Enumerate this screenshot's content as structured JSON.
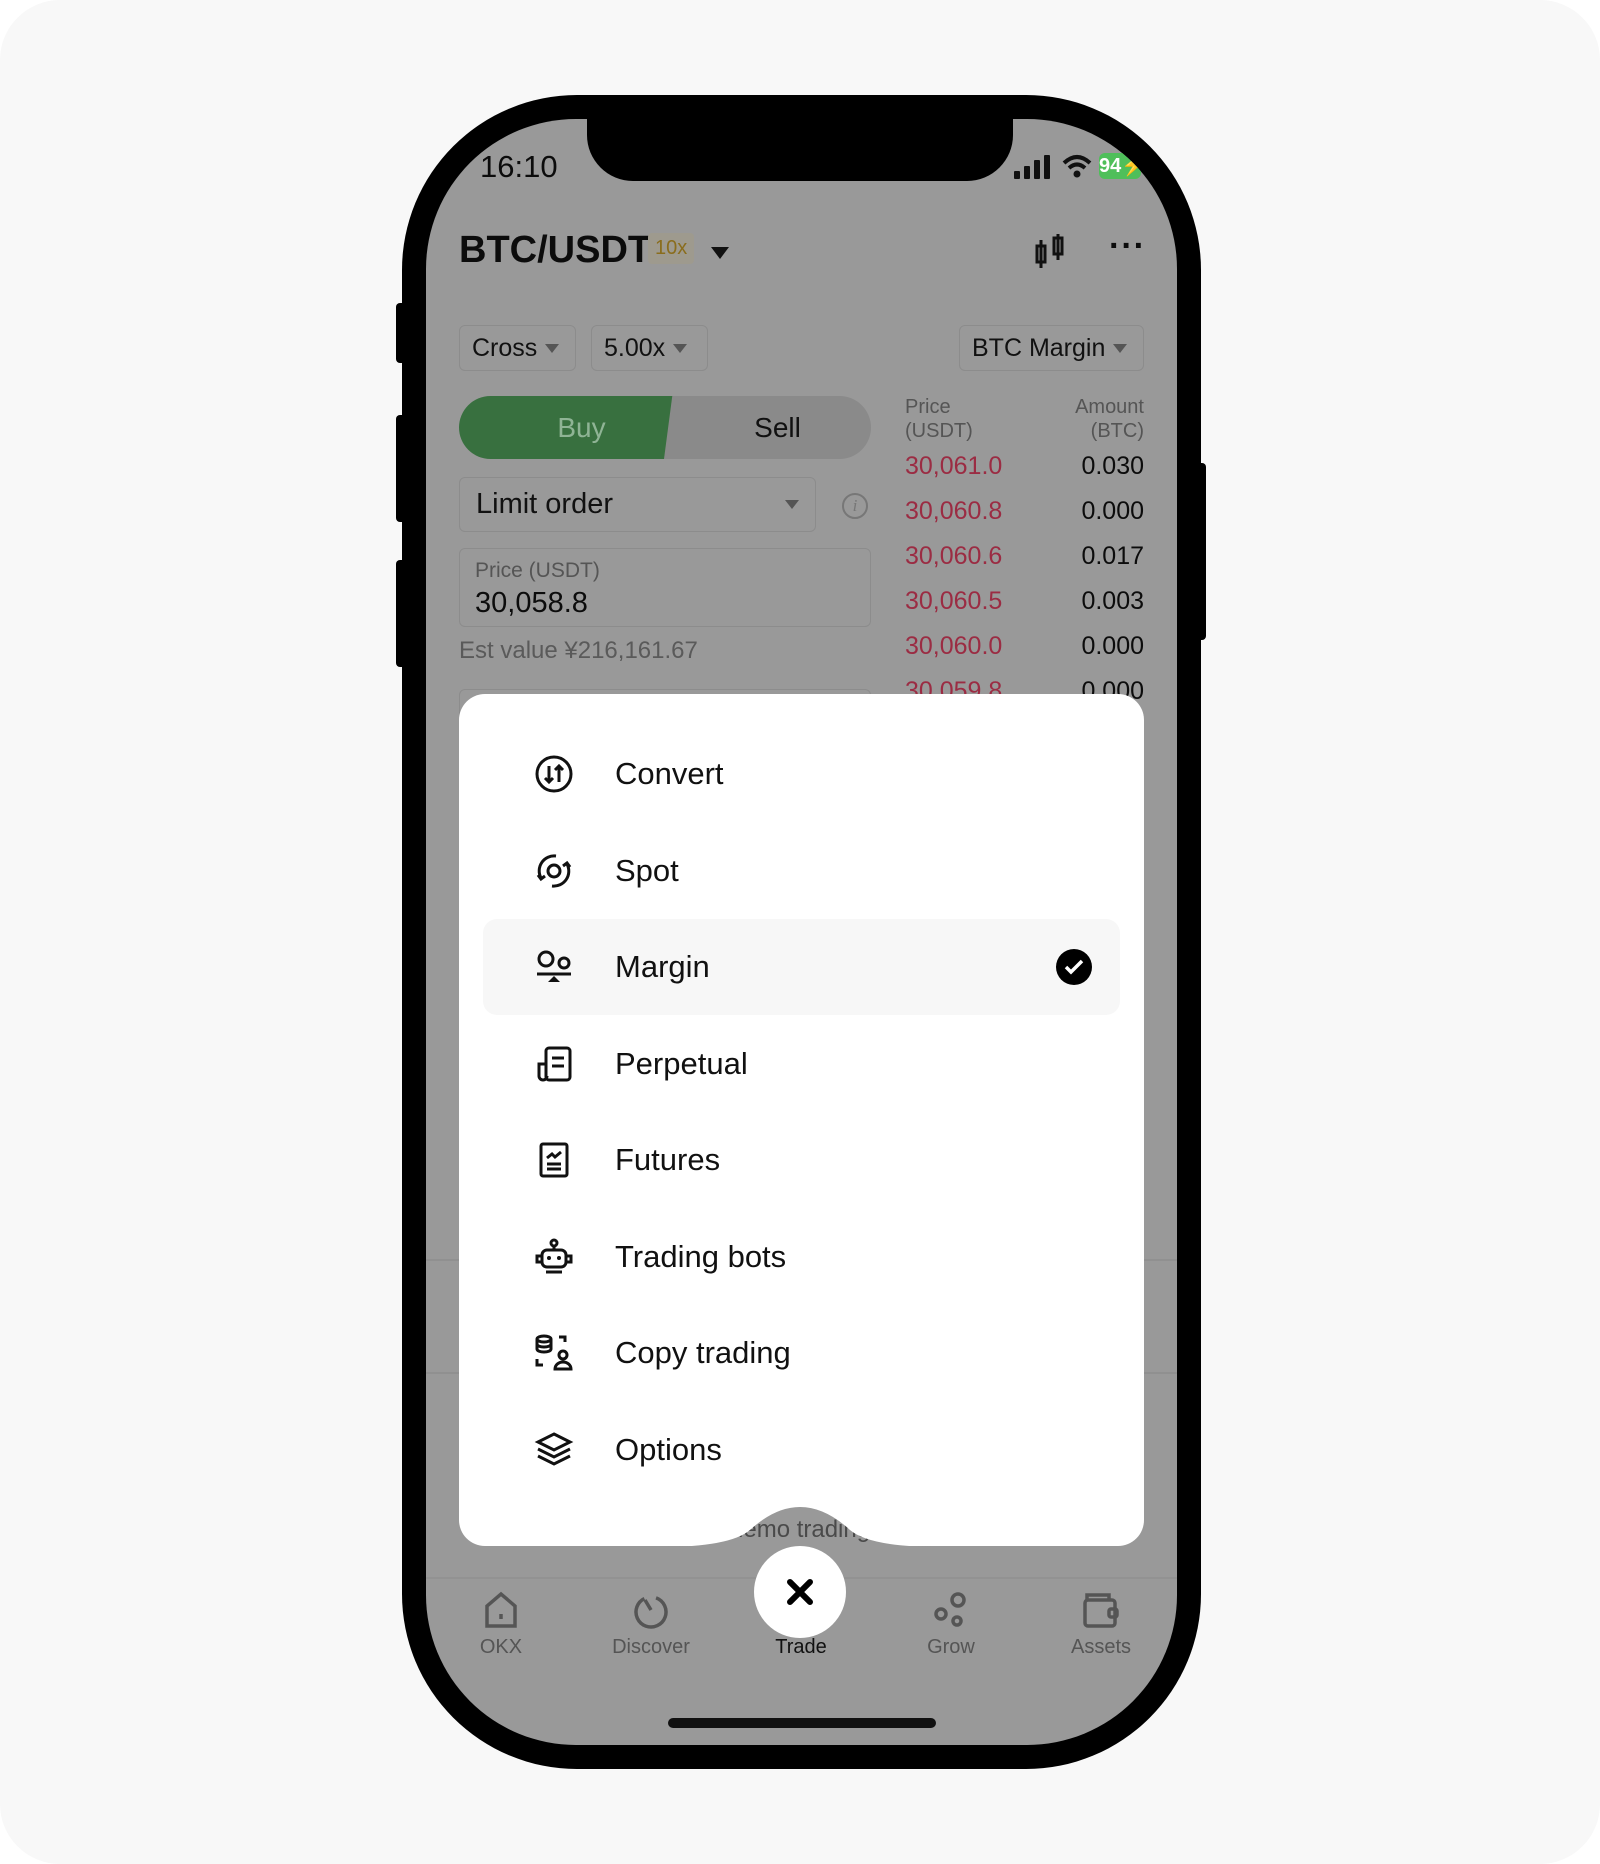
{
  "status_bar": {
    "time": "16:10",
    "battery": "94"
  },
  "header": {
    "pair": "BTC/USDT",
    "leverage_badge": "10x",
    "chart_icon": "candlestick-icon",
    "more_icon": "more-icon"
  },
  "controls": {
    "margin_mode": "Cross",
    "leverage": "5.00x",
    "margin_currency": "BTC Margin"
  },
  "trade_side": {
    "buy": "Buy",
    "sell": "Sell",
    "active": "Buy"
  },
  "order": {
    "type": "Limit order",
    "price_label": "Price (USDT)",
    "price_value": "30,058.8",
    "est_value": "Est value ¥216,161.67"
  },
  "order_book": {
    "price_header": [
      "Price",
      "(USDT)"
    ],
    "amount_header": [
      "Amount",
      "(BTC)"
    ],
    "rows": [
      {
        "price": "30,061.0",
        "amount": "0.030"
      },
      {
        "price": "30,060.8",
        "amount": "0.000"
      },
      {
        "price": "30,060.6",
        "amount": "0.017"
      },
      {
        "price": "30,060.5",
        "amount": "0.003"
      },
      {
        "price": "30,060.0",
        "amount": "0.000"
      },
      {
        "price": "30,059.8",
        "amount": "0.000"
      }
    ]
  },
  "background_text": "demo trading",
  "menu": {
    "selected": "Margin",
    "items": [
      {
        "label": "Convert",
        "icon": "convert-icon"
      },
      {
        "label": "Spot",
        "icon": "spot-icon"
      },
      {
        "label": "Margin",
        "icon": "margin-icon"
      },
      {
        "label": "Perpetual",
        "icon": "perpetual-icon"
      },
      {
        "label": "Futures",
        "icon": "futures-icon"
      },
      {
        "label": "Trading bots",
        "icon": "robot-icon"
      },
      {
        "label": "Copy trading",
        "icon": "copy-trading-icon"
      },
      {
        "label": "Options",
        "icon": "layers-icon"
      }
    ]
  },
  "tab_bar": {
    "active": "Trade",
    "items": [
      {
        "label": "OKX"
      },
      {
        "label": "Discover"
      },
      {
        "label": "Trade"
      },
      {
        "label": "Grow"
      },
      {
        "label": "Assets"
      }
    ]
  },
  "colors": {
    "buy": "#38703f",
    "ask_price": "#9b2c43",
    "overlay": "#999999",
    "sheet": "#ffffff"
  }
}
